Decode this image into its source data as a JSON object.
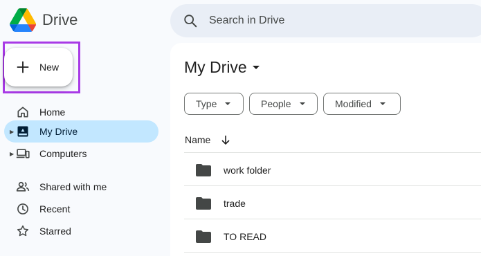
{
  "app": {
    "name": "Drive"
  },
  "search": {
    "placeholder": "Search in Drive"
  },
  "new_button": {
    "label": "New"
  },
  "nav": {
    "items": [
      {
        "label": "Home",
        "icon": "home-icon"
      },
      {
        "label": "My Drive",
        "icon": "my-drive-icon",
        "active": true,
        "expandable": true
      },
      {
        "label": "Computers",
        "icon": "computers-icon",
        "expandable": true
      },
      {
        "label": "Shared with me",
        "icon": "shared-icon"
      },
      {
        "label": "Recent",
        "icon": "clock-icon"
      },
      {
        "label": "Starred",
        "icon": "star-icon"
      }
    ]
  },
  "main": {
    "title": "My Drive",
    "filters": [
      "Type",
      "People",
      "Modified"
    ],
    "column_name": "Name",
    "files": [
      {
        "name": "work folder",
        "type": "folder"
      },
      {
        "name": "trade",
        "type": "folder"
      },
      {
        "name": "TO READ",
        "type": "folder"
      }
    ]
  },
  "colors": {
    "active_nav": "#c2e7ff",
    "highlight": "#a83ae6",
    "search_bg": "#e9eef6"
  }
}
